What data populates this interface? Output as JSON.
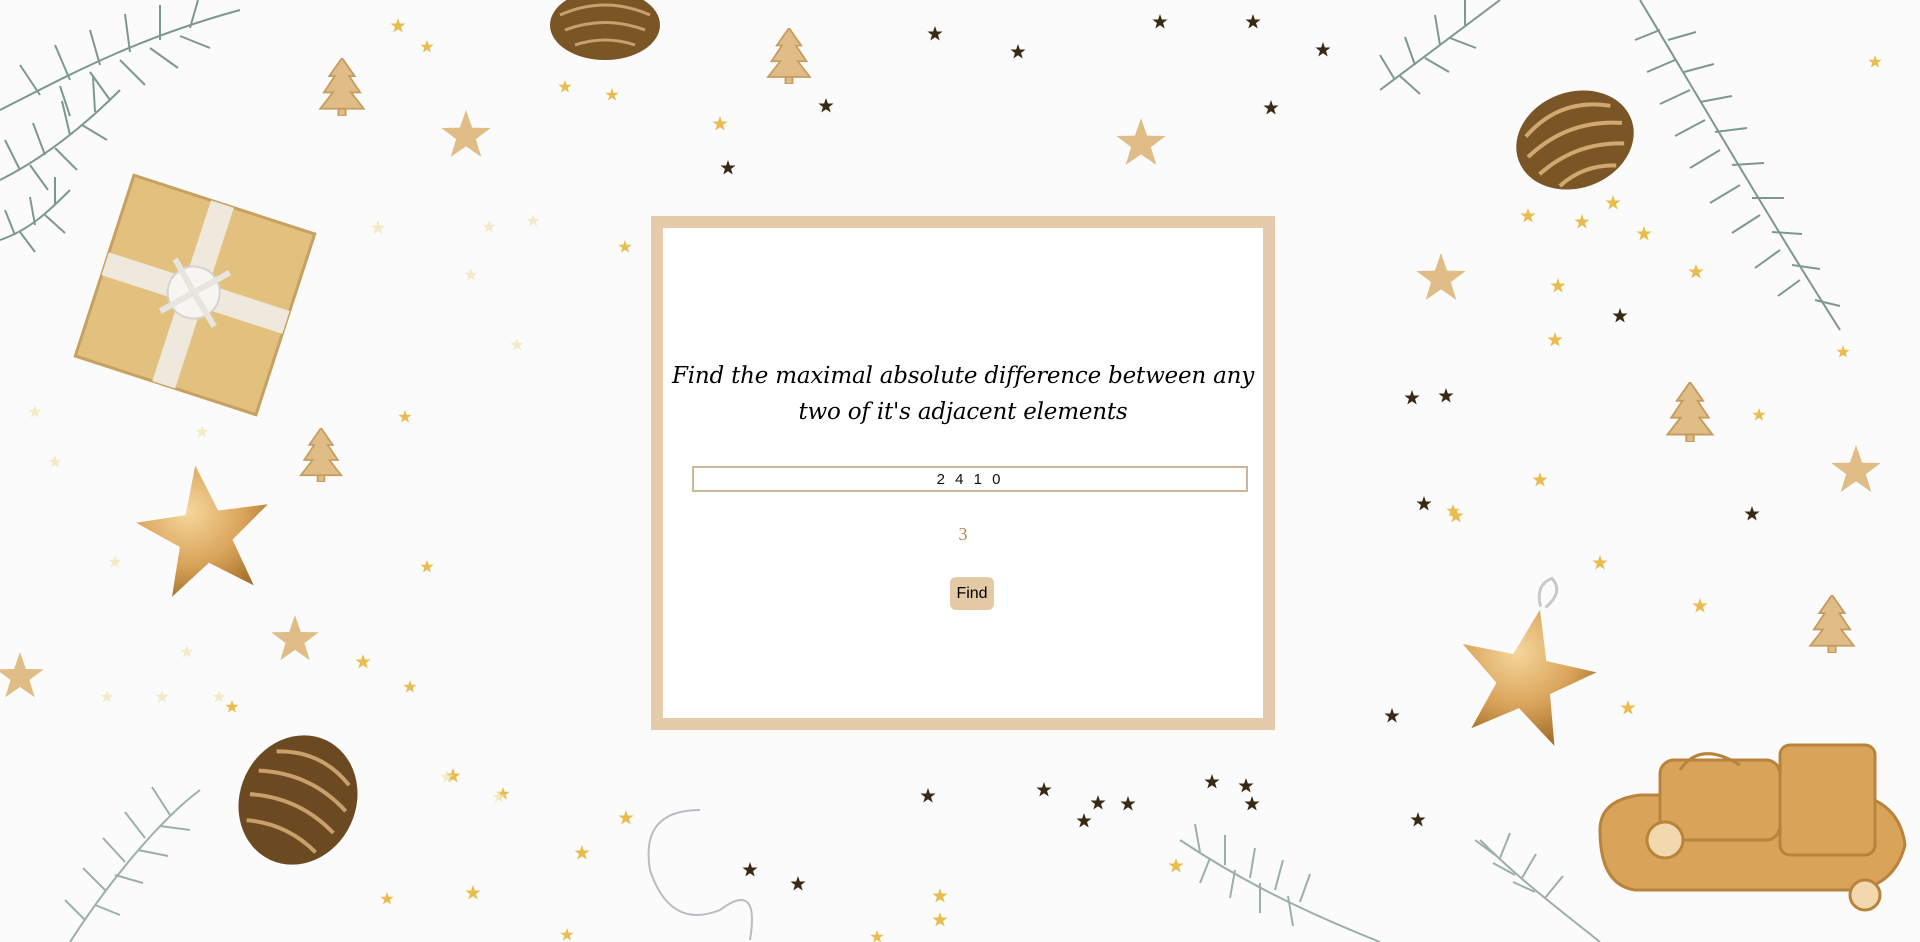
{
  "card": {
    "title_line1": "Find the maximal absolute difference between any",
    "title_line2": "two of it's adjacent elements",
    "input_value": "2 4 1 0",
    "result": "3",
    "find_label": "Find"
  },
  "colors": {
    "card_border": "#e4cba9",
    "button_bg": "#e4c9a6",
    "result_text": "#b8844e",
    "input_border": "#cdb79a",
    "gold": "#d9a45a",
    "dark_star": "#3a2a14",
    "pine": "#6f8f84",
    "pinecone": "#7a5627"
  },
  "decorations": [
    "pine-branch",
    "pinecone",
    "gift-box",
    "gold-star-ornament",
    "wooden-tree",
    "wooden-star",
    "confetti-star",
    "wooden-sled"
  ]
}
